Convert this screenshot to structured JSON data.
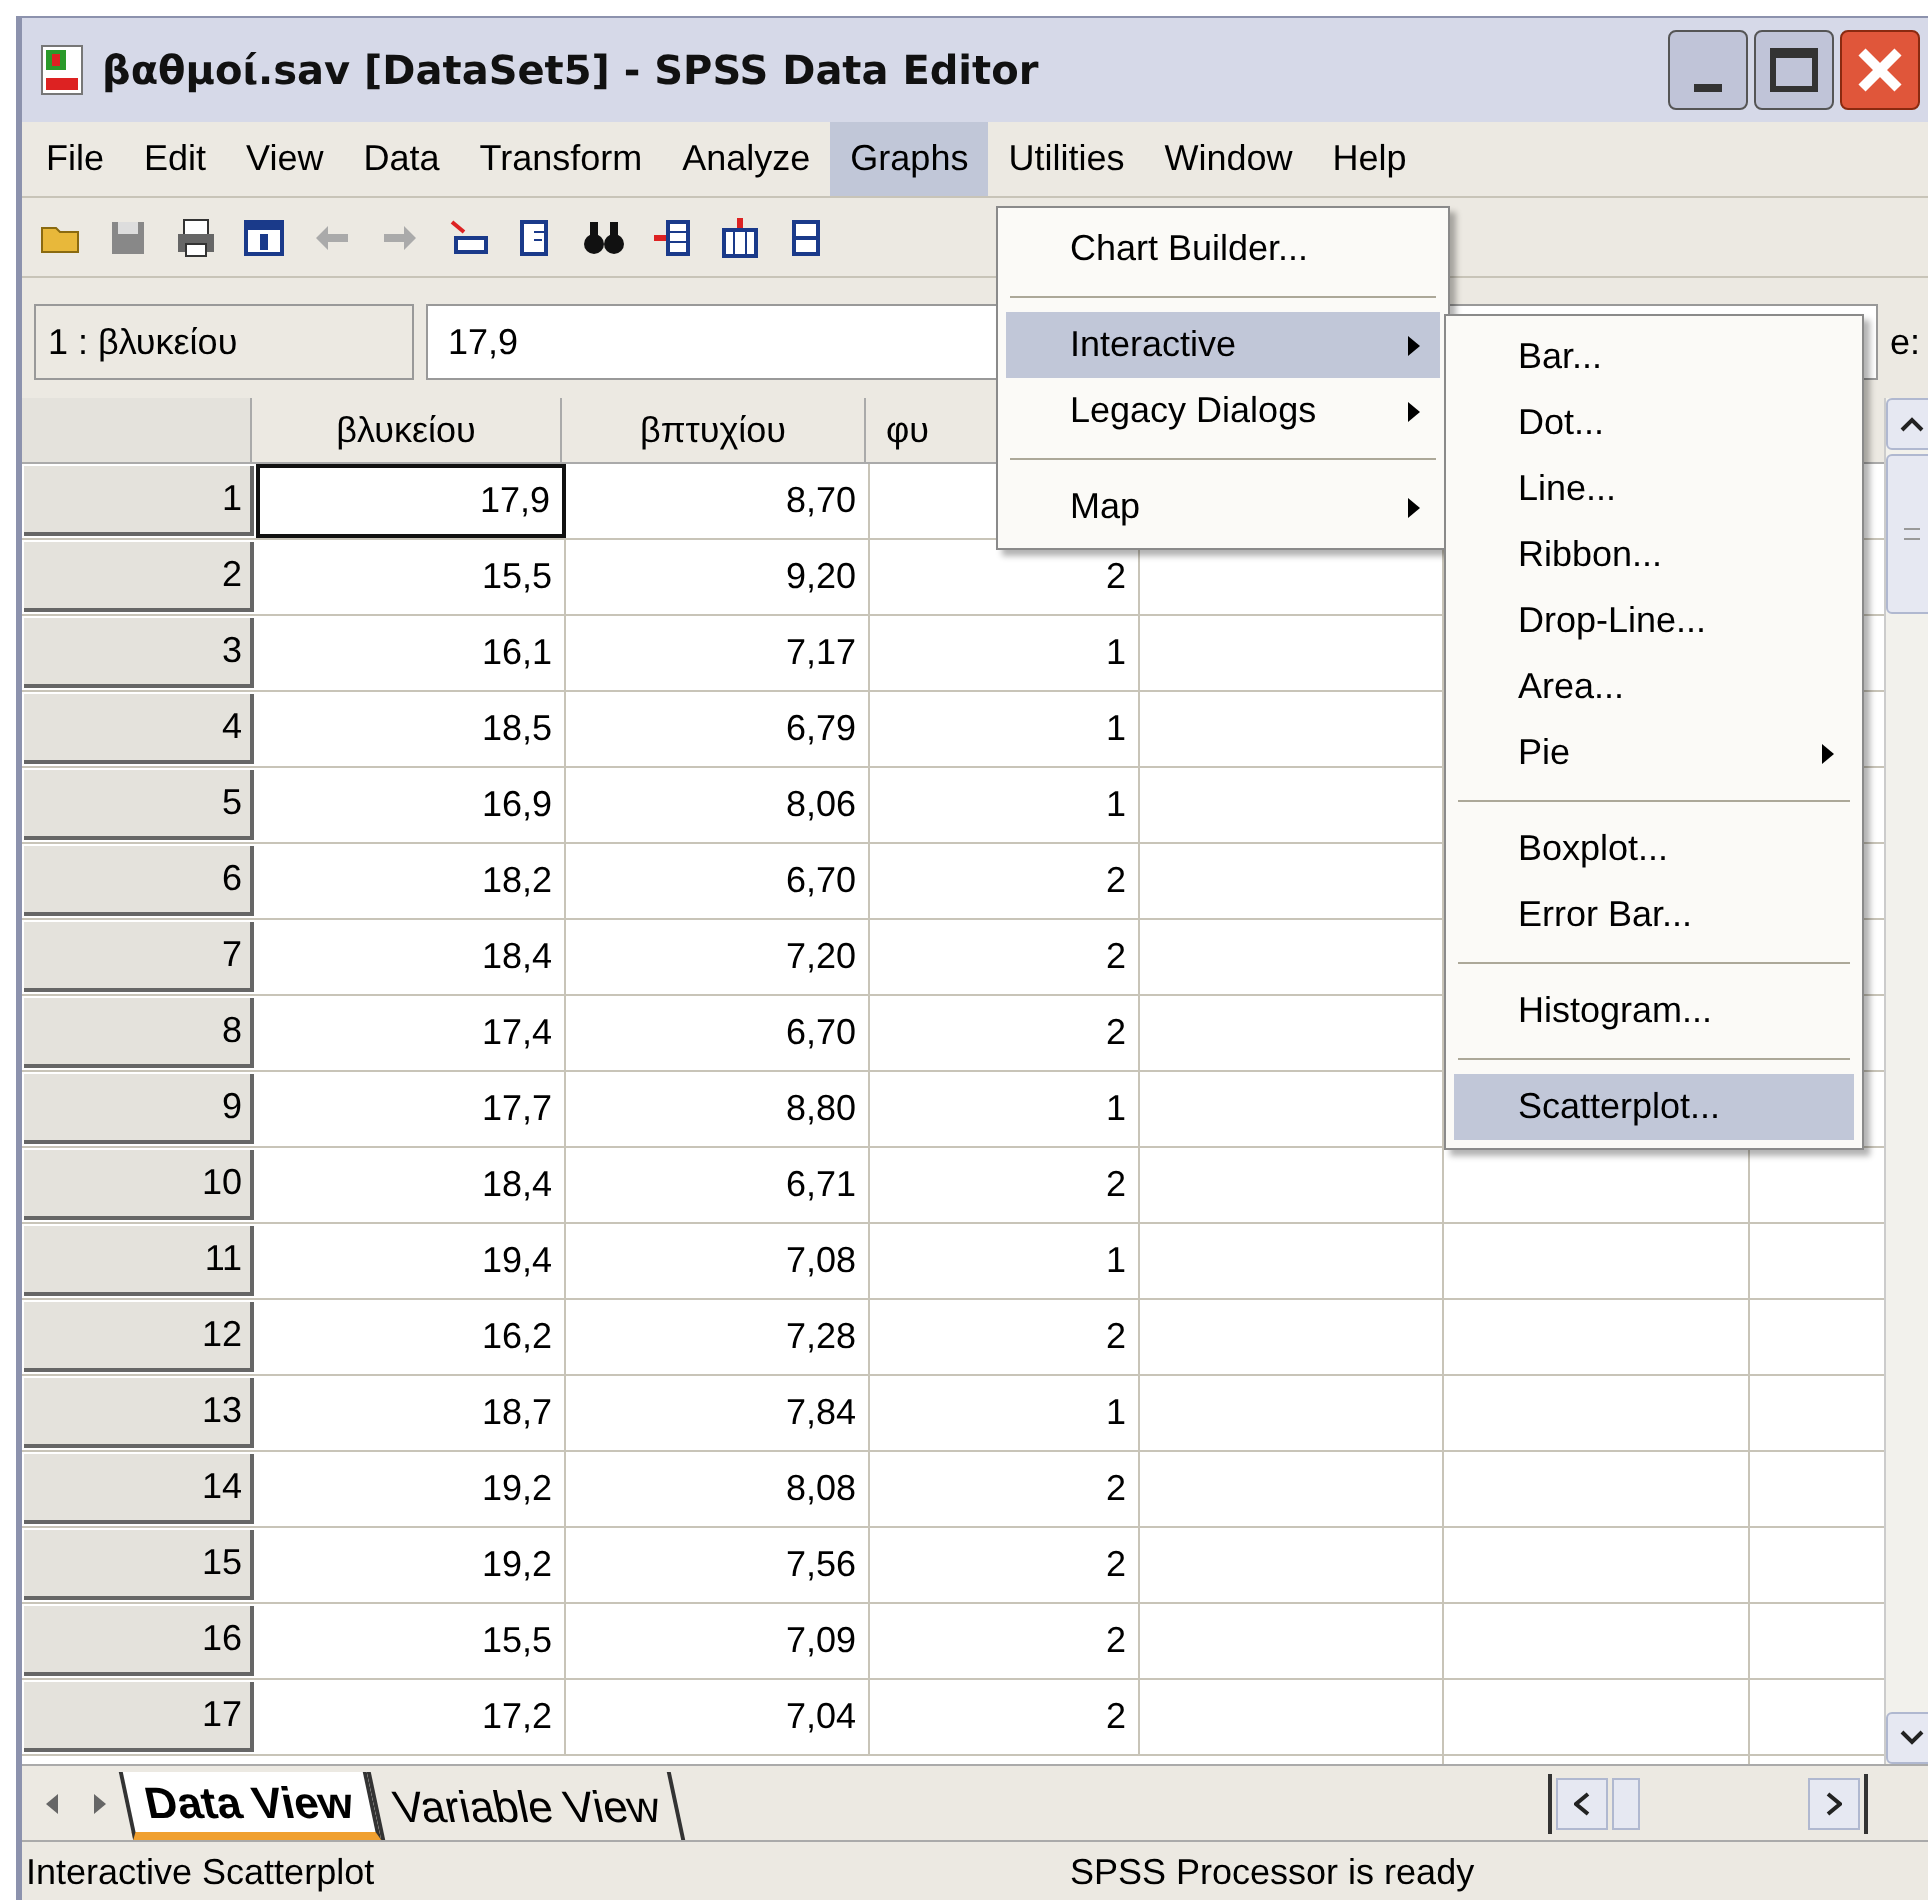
{
  "window": {
    "title": "βαθμοί.sav [DataSet5] - SPSS Data Editor"
  },
  "menu_bar": [
    {
      "label": "File",
      "selected": false
    },
    {
      "label": "Edit",
      "selected": false
    },
    {
      "label": "View",
      "selected": false
    },
    {
      "label": "Data",
      "selected": false
    },
    {
      "label": "Transform",
      "selected": false
    },
    {
      "label": "Analyze",
      "selected": false
    },
    {
      "label": "Graphs",
      "selected": true
    },
    {
      "label": "Utilities",
      "selected": false
    },
    {
      "label": "Window",
      "selected": false
    },
    {
      "label": "Help",
      "selected": false
    }
  ],
  "cell_editor": {
    "cell": "1 : βλυκείου",
    "value": "17,9",
    "label_fragment": "e:"
  },
  "table": {
    "columns": [
      "βλυκείου",
      "βπτυχίου",
      "φυ"
    ],
    "rows": [
      {
        "number": "1",
        "values": [
          "17,9",
          "8,70"
        ],
        "selected": true
      },
      {
        "number": "2",
        "values": [
          "15,5",
          "9,20",
          "2"
        ],
        "selected": false
      },
      {
        "number": "3",
        "values": [
          "16,1",
          "7,17",
          "1"
        ],
        "selected": false
      },
      {
        "number": "4",
        "values": [
          "18,5",
          "6,79",
          "1"
        ],
        "selected": false
      },
      {
        "number": "5",
        "values": [
          "16,9",
          "8,06",
          "1"
        ],
        "selected": false
      },
      {
        "number": "6",
        "values": [
          "18,2",
          "6,70",
          "2"
        ],
        "selected": false
      },
      {
        "number": "7",
        "values": [
          "18,4",
          "7,20",
          "2"
        ],
        "selected": false
      },
      {
        "number": "8",
        "values": [
          "17,4",
          "6,70",
          "2"
        ],
        "selected": false
      },
      {
        "number": "9",
        "values": [
          "17,7",
          "8,80",
          "1"
        ],
        "selected": false
      },
      {
        "number": "10",
        "values": [
          "18,4",
          "6,71",
          "2"
        ],
        "selected": false
      },
      {
        "number": "11",
        "values": [
          "19,4",
          "7,08",
          "1"
        ],
        "selected": false
      },
      {
        "number": "12",
        "values": [
          "16,2",
          "7,28",
          "2"
        ],
        "selected": false
      },
      {
        "number": "13",
        "values": [
          "18,7",
          "7,84",
          "1"
        ],
        "selected": false
      },
      {
        "number": "14",
        "values": [
          "19,2",
          "8,08",
          "2"
        ],
        "selected": false
      },
      {
        "number": "15",
        "values": [
          "19,2",
          "7,56",
          "2"
        ],
        "selected": false
      },
      {
        "number": "16",
        "values": [
          "15,5",
          "7,09",
          "2"
        ],
        "selected": false
      },
      {
        "number": "17",
        "values": [
          "17,2",
          "7,04",
          "2"
        ],
        "selected": false
      }
    ]
  },
  "graphs_menu": [
    {
      "kind": "item",
      "label": "Chart Builder...",
      "selected": false,
      "submenu": false
    },
    {
      "kind": "separator"
    },
    {
      "kind": "item",
      "label": "Interactive",
      "selected": true,
      "submenu": true
    },
    {
      "kind": "item",
      "label": "Legacy Dialogs",
      "selected": false,
      "submenu": true
    },
    {
      "kind": "separator"
    },
    {
      "kind": "item",
      "label": "Map",
      "selected": false,
      "submenu": true
    }
  ],
  "interactive_submenu": [
    {
      "kind": "item",
      "label": "Bar...",
      "selected": false,
      "submenu": false
    },
    {
      "kind": "item",
      "label": "Dot...",
      "selected": false,
      "submenu": false
    },
    {
      "kind": "item",
      "label": "Line...",
      "selected": false,
      "submenu": false
    },
    {
      "kind": "item",
      "label": "Ribbon...",
      "selected": false,
      "submenu": false
    },
    {
      "kind": "item",
      "label": "Drop-Line...",
      "selected": false,
      "submenu": false
    },
    {
      "kind": "item",
      "label": "Area...",
      "selected": false,
      "submenu": false
    },
    {
      "kind": "item",
      "label": "Pie",
      "selected": false,
      "submenu": true
    },
    {
      "kind": "separator"
    },
    {
      "kind": "item",
      "label": "Boxplot...",
      "selected": false,
      "submenu": false
    },
    {
      "kind": "item",
      "label": "Error Bar...",
      "selected": false,
      "submenu": false
    },
    {
      "kind": "separator"
    },
    {
      "kind": "item",
      "label": "Histogram...",
      "selected": false,
      "submenu": false
    },
    {
      "kind": "separator"
    },
    {
      "kind": "item",
      "label": "Scatterplot...",
      "selected": true,
      "submenu": false
    }
  ],
  "tabs": [
    {
      "label": "Data View",
      "selected": true
    },
    {
      "label": "Variable View",
      "selected": false
    }
  ],
  "status_bar": {
    "message": "Interactive Scatterplot",
    "processor": "SPSS Processor is ready"
  }
}
